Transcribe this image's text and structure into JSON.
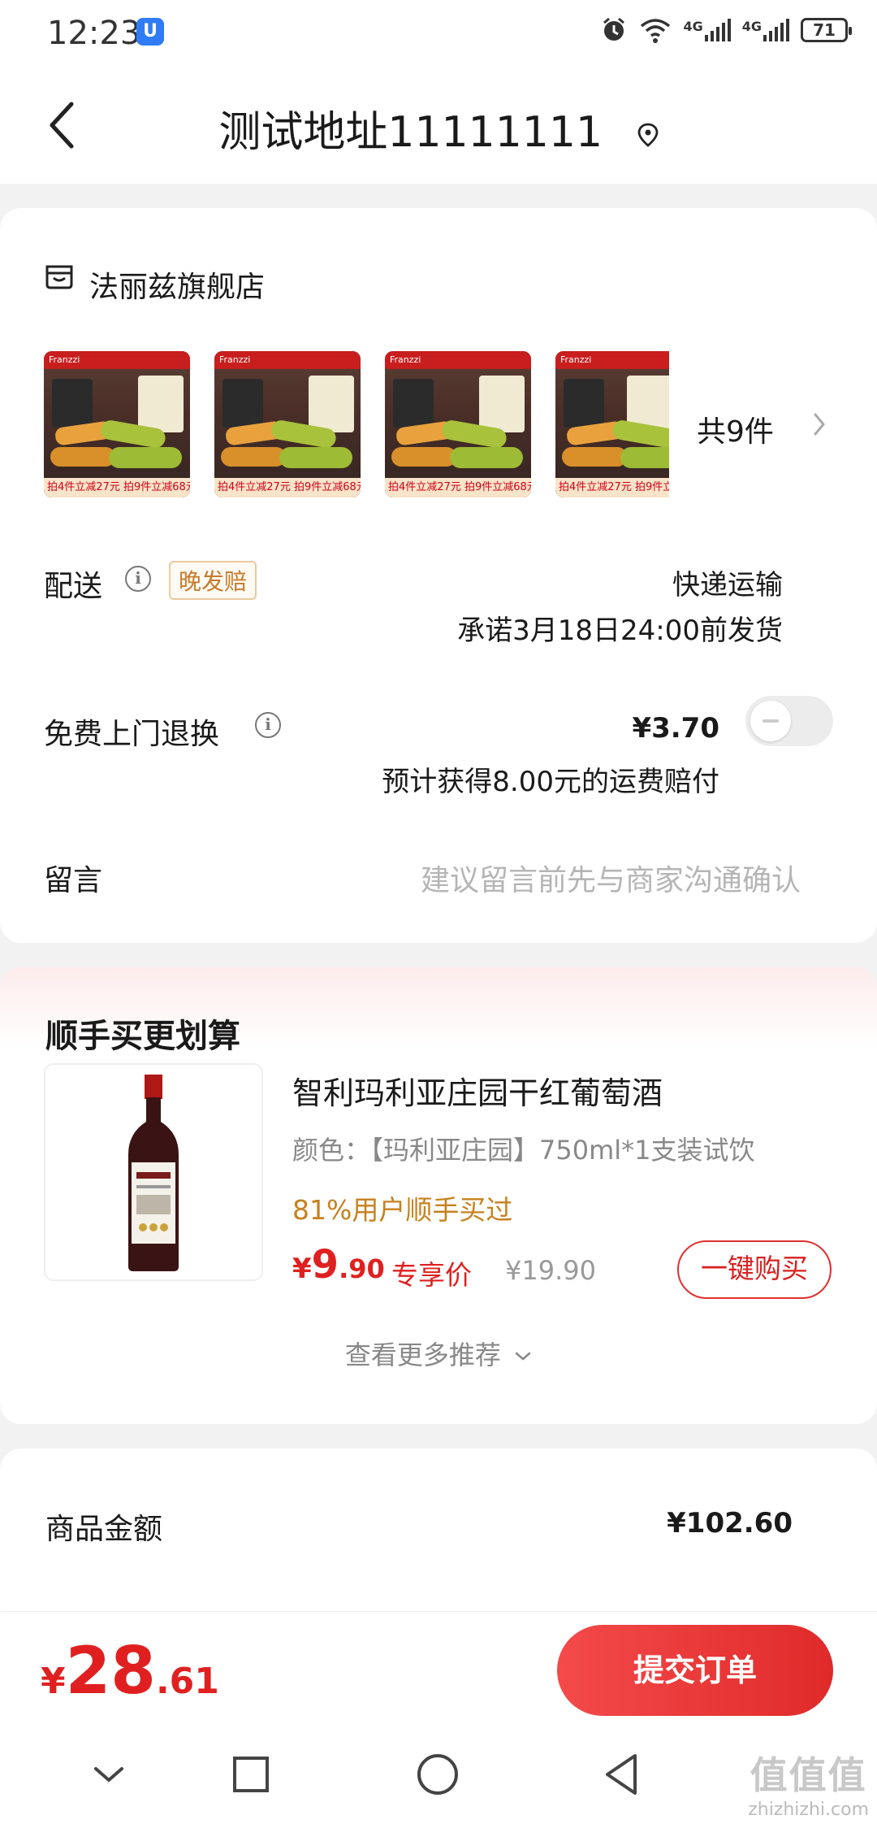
{
  "status_bar": {
    "time": "12:23",
    "battery": "71",
    "network1": "4G",
    "network2": "4G"
  },
  "header": {
    "title": "测试地址11111111"
  },
  "store": {
    "name": "法丽兹旗舰店",
    "thumbs": [
      {
        "brand": "Franzzi",
        "promo": "拍4件立减27元 拍9件立减68元"
      },
      {
        "brand": "Franzzi",
        "promo": "拍4件立减27元 拍9件立减68元"
      },
      {
        "brand": "Franzzi",
        "promo": "拍4件立减27元 拍9件立减68元"
      },
      {
        "brand": "Franzzi",
        "promo": "拍4件立减27元 拍9件立减68元"
      }
    ],
    "count_label": "共9件"
  },
  "delivery": {
    "label": "配送",
    "tag": "晚发赔",
    "method": "快递运输",
    "promise": "承诺3月18日24:00前发货"
  },
  "return_service": {
    "label": "免费上门退换",
    "price": "¥3.70",
    "note": "预计获得8.00元的运费赔付",
    "enabled": false
  },
  "message": {
    "label": "留言",
    "placeholder": "建议留言前先与商家沟通确认"
  },
  "recommend": {
    "title": "顺手买更划算",
    "item": {
      "name": "智利玛利亚庄园干红葡萄酒",
      "spec": "颜色：【玛利亚庄园】750ml*1支装试饮",
      "percent": "81%用户顺手买过",
      "price_sym": "¥",
      "price_int": "9",
      "price_dec": ".90",
      "price_tag": "专享价",
      "orig_price": "¥19.90",
      "buy_label": "一键购买"
    },
    "more_label": "查看更多推荐"
  },
  "amount": {
    "label": "商品金额",
    "value": "¥102.60"
  },
  "bottom": {
    "total_sym": "¥",
    "total_int": "28",
    "total_dec": ".61",
    "submit_label": "提交订单"
  },
  "watermark": {
    "top": "值值值",
    "url": "zhizhizhi.com"
  },
  "colors": {
    "accent": "#e02020",
    "tag": "#c77a2a",
    "percent": "#c7811f"
  }
}
